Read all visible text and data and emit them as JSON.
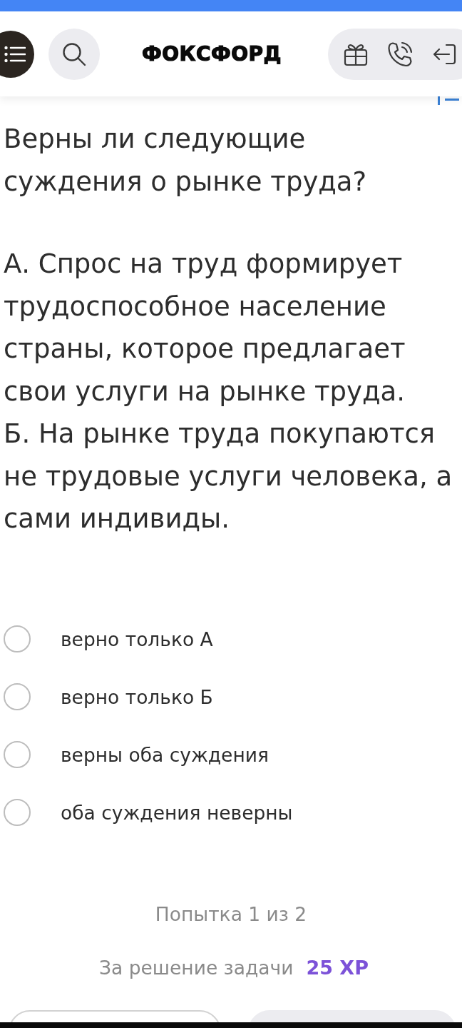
{
  "header": {
    "logo": "ФОКСФОРД"
  },
  "question": {
    "title": "Верны ли следующие суждения о рынке труда?",
    "statements": [
      "А. Спрос на труд формирует трудоспособное население страны, которое предлагает свои услуги на рынке труда.",
      "Б. На рынке труда покупаются не трудовые услуги человека, а сами индивиды."
    ]
  },
  "options": [
    {
      "label": "верно только А",
      "selected": false
    },
    {
      "label": "верно только Б",
      "selected": false
    },
    {
      "label": "верны оба суждения",
      "selected": false
    },
    {
      "label": "оба суждения неверны",
      "selected": false
    }
  ],
  "attempt": "Попытка 1 из 2",
  "reward": {
    "label": "За решение задачи",
    "points": "25 XP"
  }
}
